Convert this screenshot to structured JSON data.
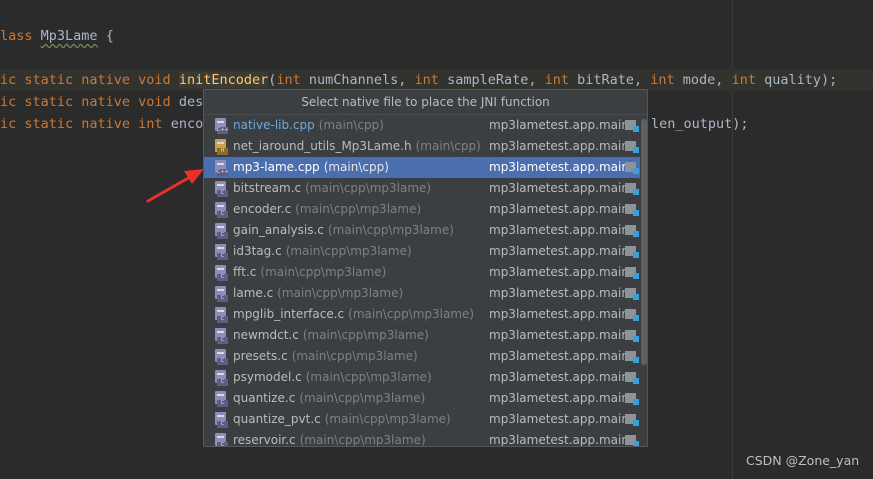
{
  "editor": {
    "line1": {
      "kw": "lass",
      "cls": "Mp3Lame",
      "rest": " {"
    },
    "line2": {
      "kw1": "ic static native void ",
      "fn": "initEncoder",
      "open": "(",
      "p1t": "int",
      "p1": " numChannels, ",
      "p2t": "int",
      "p2": " sampleRate, ",
      "p3t": "int",
      "p3": " bitRate, ",
      "p4t": "int",
      "p4": " mode, ",
      "p5t": "int",
      "p5": " quality);"
    },
    "line3": {
      "kw": "ic static native void ",
      "rest": "dest"
    },
    "line4": {
      "kw1": "ic static native ",
      "kw2": "int",
      "rest": " encod",
      "tail": "len_output);"
    }
  },
  "popup": {
    "title": "Select native file to place the JNI function",
    "items": [
      {
        "name": "native-lib.cpp",
        "path": "(main\\cpp)",
        "module": "mp3lametest.app.main",
        "tag": "C++"
      },
      {
        "name": "net_iaround_utils_Mp3Lame.h",
        "path": "(main\\cpp)",
        "module": "mp3lametest.app.main",
        "tag": "H"
      },
      {
        "name": "mp3-lame.cpp",
        "path": "(main\\cpp)",
        "module": "mp3lametest.app.main",
        "tag": "C++"
      },
      {
        "name": "bitstream.c",
        "path": "(main\\cpp\\mp3lame)",
        "module": "mp3lametest.app.main",
        "tag": "C"
      },
      {
        "name": "encoder.c",
        "path": "(main\\cpp\\mp3lame)",
        "module": "mp3lametest.app.main",
        "tag": "C"
      },
      {
        "name": "gain_analysis.c",
        "path": "(main\\cpp\\mp3lame)",
        "module": "mp3lametest.app.main",
        "tag": "C"
      },
      {
        "name": "id3tag.c",
        "path": "(main\\cpp\\mp3lame)",
        "module": "mp3lametest.app.main",
        "tag": "C"
      },
      {
        "name": "fft.c",
        "path": "(main\\cpp\\mp3lame)",
        "module": "mp3lametest.app.main",
        "tag": "C"
      },
      {
        "name": "lame.c",
        "path": "(main\\cpp\\mp3lame)",
        "module": "mp3lametest.app.main",
        "tag": "C"
      },
      {
        "name": "mpglib_interface.c",
        "path": "(main\\cpp\\mp3lame)",
        "module": "mp3lametest.app.main",
        "tag": "C"
      },
      {
        "name": "newmdct.c",
        "path": "(main\\cpp\\mp3lame)",
        "module": "mp3lametest.app.main",
        "tag": "C"
      },
      {
        "name": "presets.c",
        "path": "(main\\cpp\\mp3lame)",
        "module": "mp3lametest.app.main",
        "tag": "C"
      },
      {
        "name": "psymodel.c",
        "path": "(main\\cpp\\mp3lame)",
        "module": "mp3lametest.app.main",
        "tag": "C"
      },
      {
        "name": "quantize.c",
        "path": "(main\\cpp\\mp3lame)",
        "module": "mp3lametest.app.main",
        "tag": "C"
      },
      {
        "name": "quantize_pvt.c",
        "path": "(main\\cpp\\mp3lame)",
        "module": "mp3lametest.app.main",
        "tag": "C"
      },
      {
        "name": "reservoir.c",
        "path": "(main\\cpp\\mp3lame)",
        "module": "mp3lametest.app.main",
        "tag": "C"
      }
    ]
  },
  "colors": {
    "selection": "#4b6eaf",
    "arrow": "#e8312a",
    "keyword": "#cc7832",
    "function": "#ffc66d"
  },
  "watermark": "CSDN @Zone_yan"
}
